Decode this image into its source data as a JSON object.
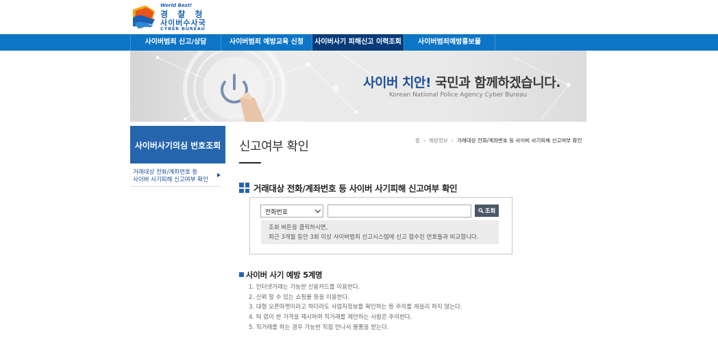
{
  "header": {
    "logo": {
      "world_best": "World Best!",
      "main": "경 찰 청",
      "sub": "사이버수사국",
      "en": "CYBER BUREAU"
    }
  },
  "nav": {
    "items": [
      {
        "label": "사이버범죄 신고/상담",
        "active": false
      },
      {
        "label": "사이버범죄 예방교육 신청",
        "active": false
      },
      {
        "label": "사이버사기 피해신고 이력조회",
        "active": true
      },
      {
        "label": "사이버범죄예방홍보물",
        "active": false
      }
    ]
  },
  "banner": {
    "title_accent": "사이버 치안!",
    "title_rest": " 국민과 함께하겠습니다.",
    "subtitle": "Korean National Police Agency Cyber Bureau"
  },
  "sidebar": {
    "title": "사이버사기의심 번호조회",
    "items": [
      {
        "line1": "거래대상 전화/계좌번호 등",
        "line2": "사이버 사기피해 신고여부 확인"
      }
    ]
  },
  "page": {
    "title": "신고여부 확인",
    "breadcrumb": [
      "홈",
      "예방정보",
      "거래대상 전화/계좌번호 등 사이버 사기피해 신고여부 확인"
    ],
    "section_title": "거래대상 전화/계좌번호 등 사이버 사기피해 신고여부 확인"
  },
  "search": {
    "select_value": "전화번호",
    "input_value": "",
    "input_placeholder": "",
    "button_label": "조회",
    "info_line1": "조회 버튼을 클릭하시면,",
    "info_line2": "최근 3개월 동안 3회 이상 사이버범죄 신고시스템에 신고 접수된 번호들과 비교합니다."
  },
  "tips": {
    "title": "사이버 사기 예방 5계명",
    "items": [
      "1. 인터넷거래는 가능한 신용카드를 이용한다.",
      "2. 신뢰 할 수 있는 쇼핑몰 등을 이용한다.",
      "3. 대형 오픈마켓이라고 하더라도 사업자정보를 확인하는 등 주의를 게을리 하지 않는다.",
      "4. 턱 없이 싼 가격을 제시하며 직거래를 제안하는 사람은 주의한다.",
      "5. 직거래를 하는 경우 가능한 직접 만나서 물품을 받는다."
    ]
  },
  "colors": {
    "nav_bg": "#0d75c6",
    "nav_active": "#073b7a",
    "sidebar_title_bg": "#2465ad",
    "accent_blue": "#1a4f9c",
    "search_button": "#4a5766"
  }
}
